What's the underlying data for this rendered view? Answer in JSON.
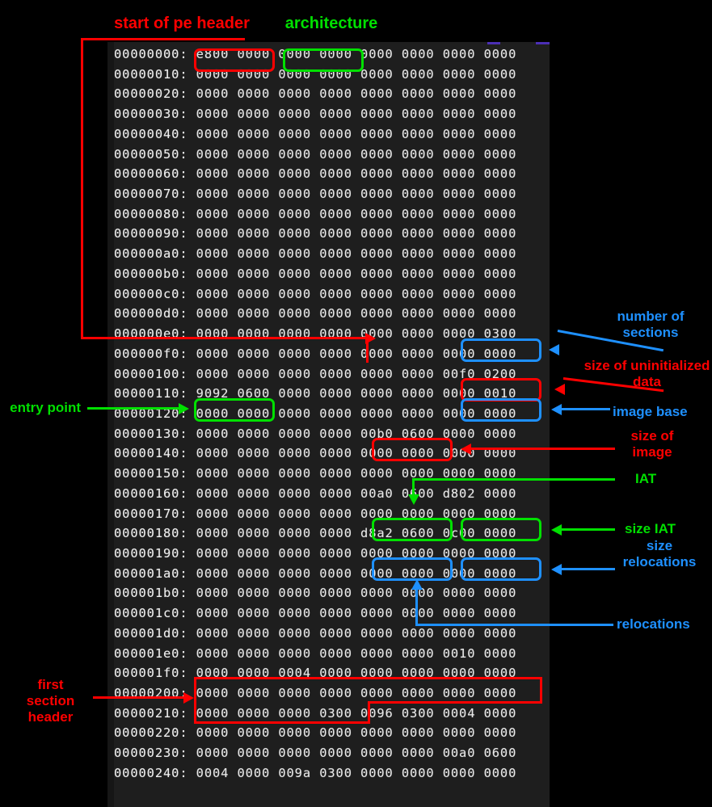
{
  "hexdump": {
    "rows": [
      {
        "addr": "00000000:",
        "groups": [
          "e800",
          "0000",
          "0000",
          "0000",
          "0000",
          "0000",
          "0000",
          "0000"
        ]
      },
      {
        "addr": "00000010:",
        "groups": [
          "0000",
          "0000",
          "0000",
          "0000",
          "0000",
          "0000",
          "0000",
          "0000"
        ]
      },
      {
        "addr": "00000020:",
        "groups": [
          "0000",
          "0000",
          "0000",
          "0000",
          "0000",
          "0000",
          "0000",
          "0000"
        ]
      },
      {
        "addr": "00000030:",
        "groups": [
          "0000",
          "0000",
          "0000",
          "0000",
          "0000",
          "0000",
          "0000",
          "0000"
        ]
      },
      {
        "addr": "00000040:",
        "groups": [
          "0000",
          "0000",
          "0000",
          "0000",
          "0000",
          "0000",
          "0000",
          "0000"
        ]
      },
      {
        "addr": "00000050:",
        "groups": [
          "0000",
          "0000",
          "0000",
          "0000",
          "0000",
          "0000",
          "0000",
          "0000"
        ]
      },
      {
        "addr": "00000060:",
        "groups": [
          "0000",
          "0000",
          "0000",
          "0000",
          "0000",
          "0000",
          "0000",
          "0000"
        ]
      },
      {
        "addr": "00000070:",
        "groups": [
          "0000",
          "0000",
          "0000",
          "0000",
          "0000",
          "0000",
          "0000",
          "0000"
        ]
      },
      {
        "addr": "00000080:",
        "groups": [
          "0000",
          "0000",
          "0000",
          "0000",
          "0000",
          "0000",
          "0000",
          "0000"
        ]
      },
      {
        "addr": "00000090:",
        "groups": [
          "0000",
          "0000",
          "0000",
          "0000",
          "0000",
          "0000",
          "0000",
          "0000"
        ]
      },
      {
        "addr": "000000a0:",
        "groups": [
          "0000",
          "0000",
          "0000",
          "0000",
          "0000",
          "0000",
          "0000",
          "0000"
        ]
      },
      {
        "addr": "000000b0:",
        "groups": [
          "0000",
          "0000",
          "0000",
          "0000",
          "0000",
          "0000",
          "0000",
          "0000"
        ]
      },
      {
        "addr": "000000c0:",
        "groups": [
          "0000",
          "0000",
          "0000",
          "0000",
          "0000",
          "0000",
          "0000",
          "0000"
        ]
      },
      {
        "addr": "000000d0:",
        "groups": [
          "0000",
          "0000",
          "0000",
          "0000",
          "0000",
          "0000",
          "0000",
          "0000"
        ]
      },
      {
        "addr": "000000e0:",
        "groups": [
          "0000",
          "0000",
          "0000",
          "0000",
          "0000",
          "0000",
          "0000",
          "0300"
        ]
      },
      {
        "addr": "000000f0:",
        "groups": [
          "0000",
          "0000",
          "0000",
          "0000",
          "0000",
          "0000",
          "0000",
          "0000"
        ]
      },
      {
        "addr": "00000100:",
        "groups": [
          "0000",
          "0000",
          "0000",
          "0000",
          "0000",
          "0000",
          "00f0",
          "0200"
        ]
      },
      {
        "addr": "00000110:",
        "groups": [
          "9092",
          "0600",
          "0000",
          "0000",
          "0000",
          "0000",
          "0000",
          "0010"
        ]
      },
      {
        "addr": "00000120:",
        "groups": [
          "0000",
          "0000",
          "0000",
          "0000",
          "0000",
          "0000",
          "0000",
          "0000"
        ]
      },
      {
        "addr": "00000130:",
        "groups": [
          "0000",
          "0000",
          "0000",
          "0000",
          "00b0",
          "0600",
          "0000",
          "0000"
        ]
      },
      {
        "addr": "00000140:",
        "groups": [
          "0000",
          "0000",
          "0000",
          "0000",
          "0000",
          "0000",
          "0000",
          "0000"
        ]
      },
      {
        "addr": "00000150:",
        "groups": [
          "0000",
          "0000",
          "0000",
          "0000",
          "0000",
          "0000",
          "0000",
          "0000"
        ]
      },
      {
        "addr": "00000160:",
        "groups": [
          "0000",
          "0000",
          "0000",
          "0000",
          "00a0",
          "0600",
          "d802",
          "0000"
        ]
      },
      {
        "addr": "00000170:",
        "groups": [
          "0000",
          "0000",
          "0000",
          "0000",
          "0000",
          "0000",
          "0000",
          "0000"
        ]
      },
      {
        "addr": "00000180:",
        "groups": [
          "0000",
          "0000",
          "0000",
          "0000",
          "d8a2",
          "0600",
          "0c00",
          "0000"
        ]
      },
      {
        "addr": "00000190:",
        "groups": [
          "0000",
          "0000",
          "0000",
          "0000",
          "0000",
          "0000",
          "0000",
          "0000"
        ]
      },
      {
        "addr": "000001a0:",
        "groups": [
          "0000",
          "0000",
          "0000",
          "0000",
          "0000",
          "0000",
          "0000",
          "0000"
        ]
      },
      {
        "addr": "000001b0:",
        "groups": [
          "0000",
          "0000",
          "0000",
          "0000",
          "0000",
          "0000",
          "0000",
          "0000"
        ]
      },
      {
        "addr": "000001c0:",
        "groups": [
          "0000",
          "0000",
          "0000",
          "0000",
          "0000",
          "0000",
          "0000",
          "0000"
        ]
      },
      {
        "addr": "000001d0:",
        "groups": [
          "0000",
          "0000",
          "0000",
          "0000",
          "0000",
          "0000",
          "0000",
          "0000"
        ]
      },
      {
        "addr": "000001e0:",
        "groups": [
          "0000",
          "0000",
          "0000",
          "0000",
          "0000",
          "0000",
          "0010",
          "0000"
        ]
      },
      {
        "addr": "000001f0:",
        "groups": [
          "0000",
          "0000",
          "0004",
          "0000",
          "0000",
          "0000",
          "0000",
          "0000"
        ]
      },
      {
        "addr": "00000200:",
        "groups": [
          "0000",
          "0000",
          "0000",
          "0000",
          "0000",
          "0000",
          "0000",
          "0000"
        ]
      },
      {
        "addr": "00000210:",
        "groups": [
          "0000",
          "0000",
          "0000",
          "0300",
          "0096",
          "0300",
          "0004",
          "0000"
        ]
      },
      {
        "addr": "00000220:",
        "groups": [
          "0000",
          "0000",
          "0000",
          "0000",
          "0000",
          "0000",
          "0000",
          "0000"
        ]
      },
      {
        "addr": "00000230:",
        "groups": [
          "0000",
          "0000",
          "0000",
          "0000",
          "0000",
          "0000",
          "00a0",
          "0600"
        ]
      },
      {
        "addr": "00000240:",
        "groups": [
          "0004",
          "0000",
          "009a",
          "0300",
          "0000",
          "0000",
          "0000",
          "0000"
        ]
      }
    ]
  },
  "annotations": {
    "start_of_pe_header": "start of pe header",
    "architecture": "architecture",
    "entry_point": "entry point",
    "number_of_sections": "number of\nsections",
    "size_of_uninitialized_data": "size of uninitialized\ndata",
    "image_base": "image base",
    "size_of_image": "size of\nimage",
    "iat": "IAT",
    "size_iat": "size IAT",
    "size_relocations": "size\nrelocations",
    "relocations": "relocations",
    "first_section_header": "first\nsection\nheader"
  },
  "colors": {
    "red": "#ff0000",
    "green": "#00e000",
    "blue": "#1e90ff",
    "panel_bg": "#1e1e1e",
    "hex_text": "#e9e9e9",
    "page_bg": "#000000"
  }
}
